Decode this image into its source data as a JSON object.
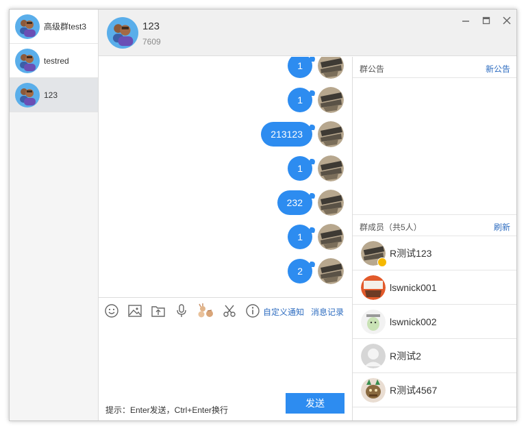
{
  "sessions": [
    {
      "name": "高级群test3"
    },
    {
      "name": "testred"
    },
    {
      "name": "123"
    }
  ],
  "header": {
    "title": "123",
    "subtitle": "7609"
  },
  "messages": [
    {
      "text": "1"
    },
    {
      "text": "1"
    },
    {
      "text": "213123"
    },
    {
      "text": "1"
    },
    {
      "text": "232"
    },
    {
      "text": "1"
    },
    {
      "text": "2"
    }
  ],
  "toolbar": {
    "icons": [
      "emoji-icon",
      "image-icon",
      "upload-icon",
      "microphone-icon",
      "rock-paper-scissors-icon",
      "scissors-icon",
      "info-icon"
    ],
    "custom_notify": "自定义通知",
    "history": "消息记录"
  },
  "input": {
    "hint": "提示：Enter发送，Ctrl+Enter换行",
    "send_label": "发送"
  },
  "notice": {
    "title": "群公告",
    "action": "新公告"
  },
  "members": {
    "title": "群成员（共5人）",
    "action": "刷新",
    "list": [
      {
        "name": "R测试123",
        "owner": true
      },
      {
        "name": "lswnick001"
      },
      {
        "name": "lswnick002"
      },
      {
        "name": "R测试2"
      },
      {
        "name": "R测试4567"
      }
    ]
  },
  "colors": {
    "accent": "#2d8cf0",
    "link": "#2d6cc0",
    "active_session": "#e3e5e8"
  }
}
